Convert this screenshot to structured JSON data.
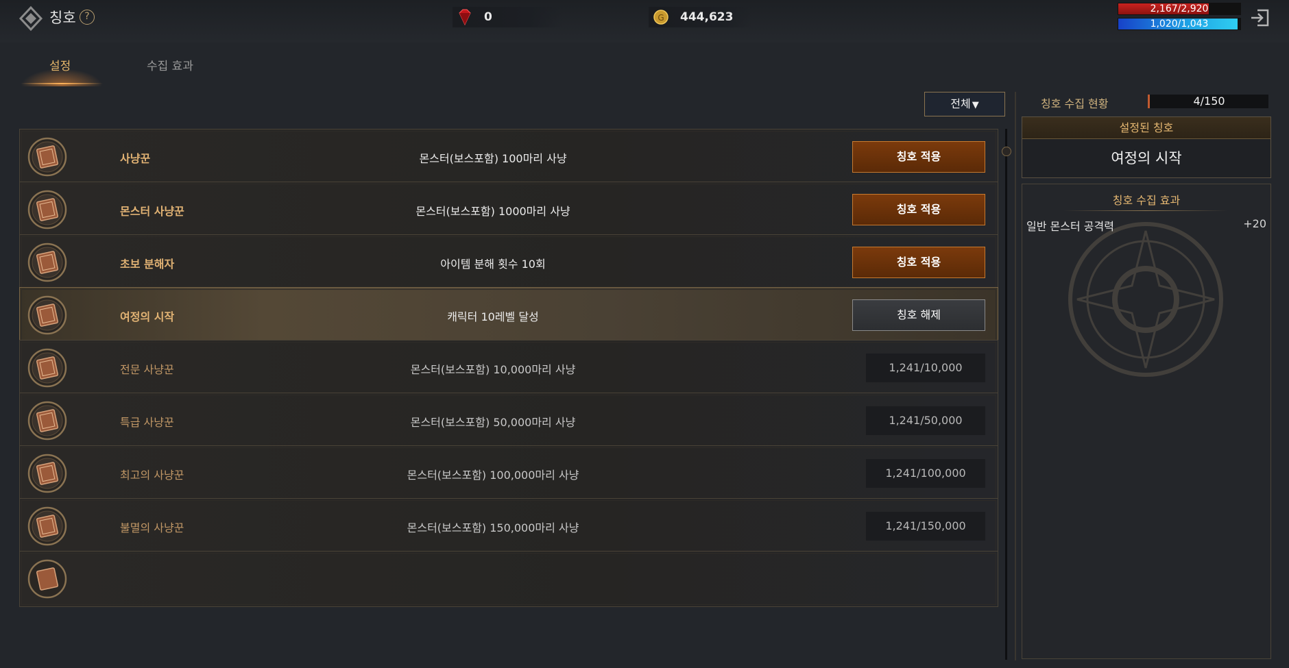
{
  "header": {
    "title": "칭호",
    "help_glyph": "?",
    "ruby_value": "0",
    "gold_value": "444,623",
    "hp_text": "2,167/2,920",
    "hp_fraction": 0.742,
    "mp_text": "1,020/1,043",
    "mp_fraction": 0.978
  },
  "tabs": {
    "settings": "설정",
    "collection_effect": "수집 효과"
  },
  "filter": {
    "label": "전체",
    "caret": "▼"
  },
  "titles": [
    {
      "name": "사냥꾼",
      "condition": "몬스터(보스포함) 100마리 사냥",
      "action": "칭호 적용",
      "state": "available"
    },
    {
      "name": "몬스터 사냥꾼",
      "condition": "몬스터(보스포함) 1000마리 사냥",
      "action": "칭호 적용",
      "state": "available"
    },
    {
      "name": "초보 분해자",
      "condition": "아이템 분해 횟수 10회",
      "action": "칭호 적용",
      "state": "available"
    },
    {
      "name": "여정의 시작",
      "condition": "캐릭터 10레벨 달성",
      "action": "칭호 해제",
      "state": "equipped"
    },
    {
      "name": "전문 사냥꾼",
      "condition": "몬스터(보스포함) 10,000마리 사냥",
      "progress": "1,241/10,000",
      "state": "locked"
    },
    {
      "name": "특급 사냥꾼",
      "condition": "몬스터(보스포함) 50,000마리 사냥",
      "progress": "1,241/50,000",
      "state": "locked"
    },
    {
      "name": "최고의 사냥꾼",
      "condition": "몬스터(보스포함) 100,000마리 사냥",
      "progress": "1,241/100,000",
      "state": "locked"
    },
    {
      "name": "불멸의 사냥꾼",
      "condition": "몬스터(보스포함) 150,000마리 사냥",
      "progress": "1,241/150,000",
      "state": "locked"
    }
  ],
  "side": {
    "collection_status_label": "칭호 수집 현황",
    "collection_status_value": "4/150",
    "equipped_header": "설정된 칭호",
    "equipped_title": "여정의 시작",
    "effect_header": "칭호 수집 효과",
    "effects": [
      {
        "label": "일반 몬스터 공격력",
        "value": "+20"
      }
    ]
  },
  "colors": {
    "accent": "#e2b374",
    "button": "#7b3a0c",
    "hp": "#c8231f",
    "mp": "#1fa5e6"
  }
}
